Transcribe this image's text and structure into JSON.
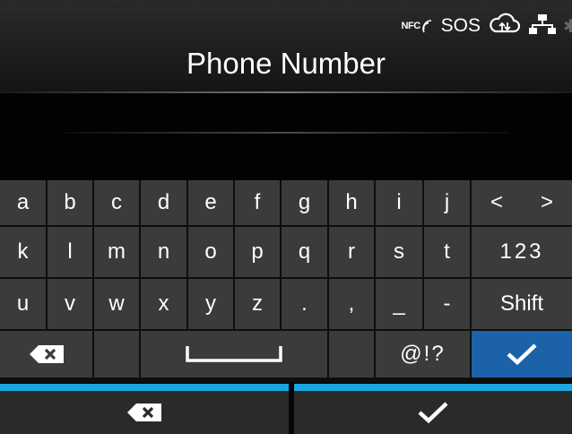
{
  "status_bar": {
    "nfc_label": "NFC",
    "sos_label": "SOS",
    "icons": [
      "nfc-icon",
      "sos-indicator",
      "cloud-sync-icon",
      "network-icon",
      "bluetooth-icon"
    ]
  },
  "header": {
    "title": "Phone Number"
  },
  "input": {
    "value": ""
  },
  "keyboard": {
    "row1": [
      "a",
      "b",
      "c",
      "d",
      "e",
      "f",
      "g",
      "h",
      "i",
      "j"
    ],
    "row2": [
      "k",
      "l",
      "m",
      "n",
      "o",
      "p",
      "q",
      "r",
      "s",
      "t"
    ],
    "row3": [
      "u",
      "v",
      "w",
      "x",
      "y",
      "z",
      ".",
      ",",
      "_",
      "-"
    ],
    "left_arrow": "<",
    "right_arrow": ">",
    "numeric_mode": "123",
    "shift": "Shift",
    "symbols_mode": "@!?"
  },
  "colors": {
    "accent": "#1aa6e0",
    "confirm": "#1b62a9",
    "key": "#3b3b3b"
  }
}
